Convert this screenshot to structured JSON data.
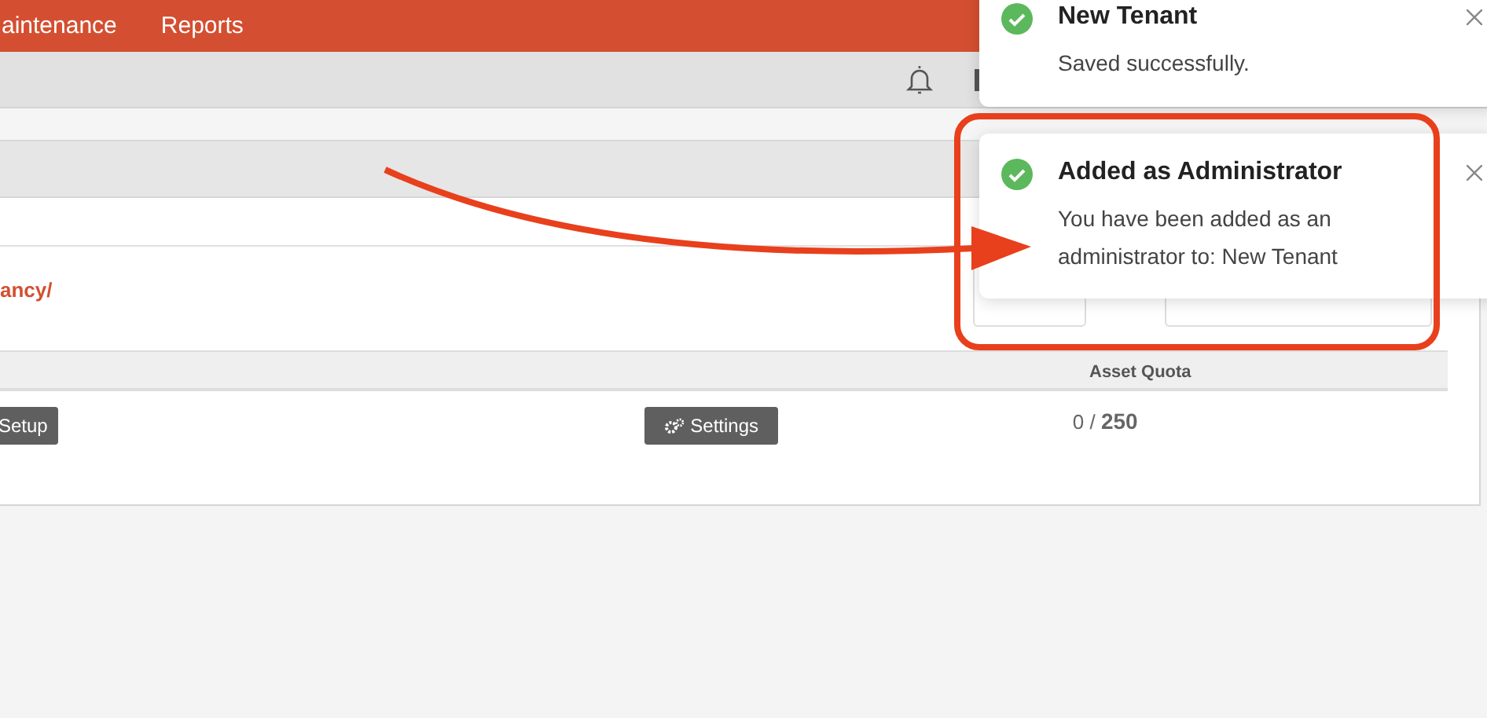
{
  "nav": {
    "items": [
      {
        "label": "aintenance"
      },
      {
        "label": "Reports"
      }
    ]
  },
  "panel": {
    "link": "ancy/",
    "table": {
      "columns": [
        "Asset Quota"
      ],
      "row": {
        "setup_button": "Setup",
        "settings_button": "Settings",
        "quota_used": "0 /",
        "quota_total": "250"
      }
    }
  },
  "toasts": [
    {
      "title": "New Tenant",
      "message": "Saved successfully.",
      "highlighted": false
    },
    {
      "title": "Added as Administrator",
      "message": "You have been added as an administrator to: New Tenant",
      "highlighted": true
    }
  ]
}
